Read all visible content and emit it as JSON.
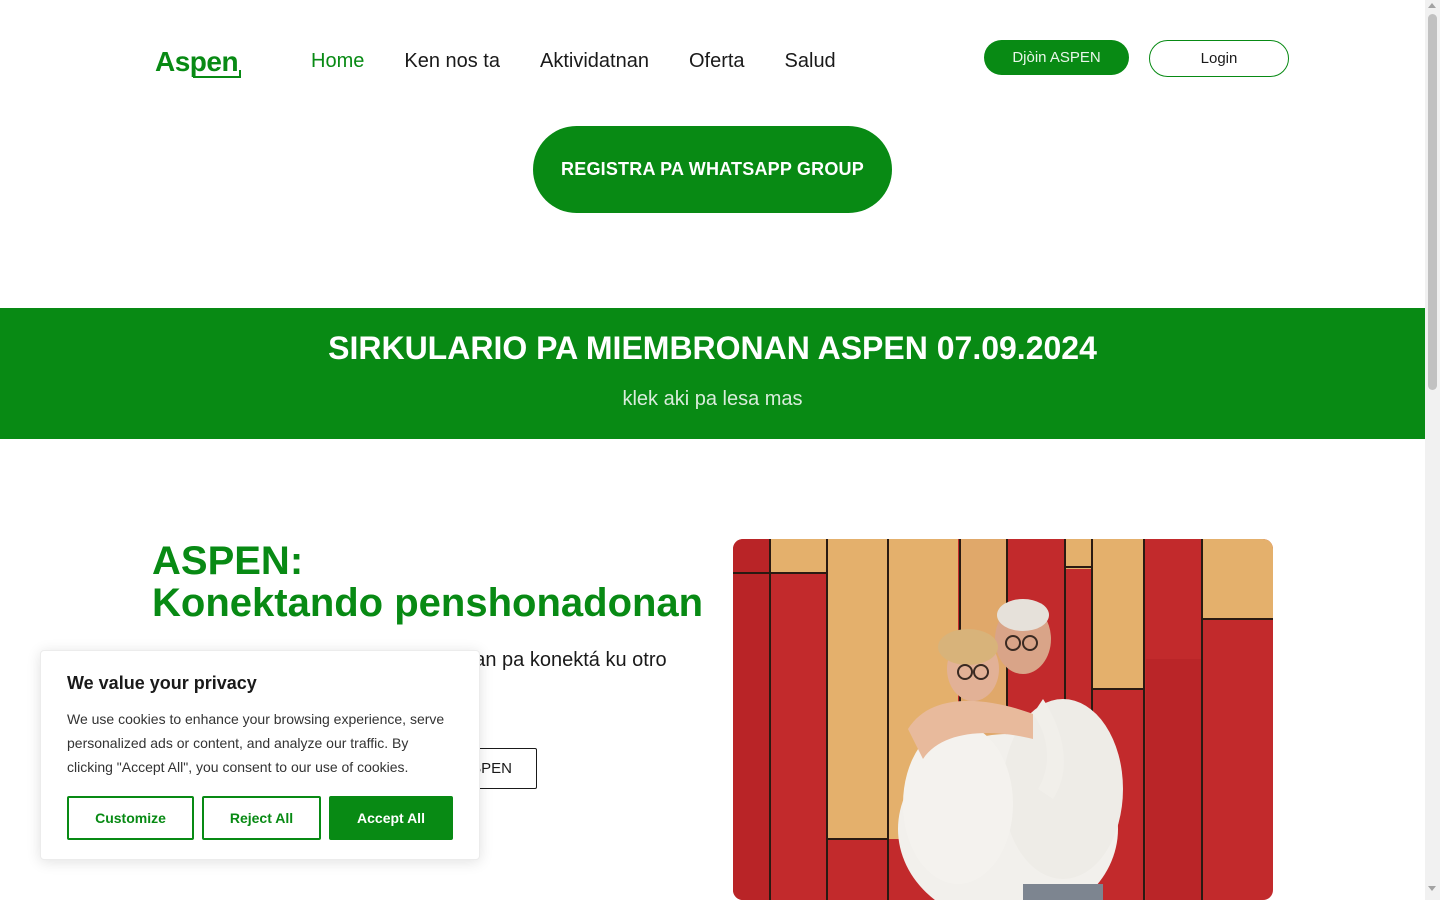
{
  "header": {
    "logo": "Aspen",
    "nav": [
      {
        "label": "Home",
        "active": true
      },
      {
        "label": "Ken nos ta",
        "active": false
      },
      {
        "label": "Aktividatnan",
        "active": false
      },
      {
        "label": "Oferta",
        "active": false
      },
      {
        "label": "Salud",
        "active": false
      }
    ],
    "join_label": "Djòin ASPEN",
    "login_label": "Login"
  },
  "whatsapp_label": "REGISTRA PA WHATSAPP GROUP",
  "banner": {
    "title": "SIRKULARIO PA MIEMBRONAN ASPEN 07.09.2024",
    "link": "klek aki pa lesa mas"
  },
  "hero": {
    "title_line1": "ASPEN:",
    "title_line2": "Konektando penshonadonan",
    "text_line1": "onan pa konektá ku otro",
    "text_line2": "n.",
    "button_label": "SPEN"
  },
  "cookie": {
    "title": "We value your privacy",
    "text": "We use cookies to enhance your browsing experience, serve personalized ads or content, and analyze our traffic. By clicking \"Accept All\", you consent to our use of cookies.",
    "customize": "Customize",
    "reject": "Reject All",
    "accept": "Accept All"
  },
  "colors": {
    "brand_green": "#088a14",
    "text_dark": "#1a1a1a",
    "photo_red": "#c22a2c",
    "photo_tan": "#e4b06c"
  }
}
